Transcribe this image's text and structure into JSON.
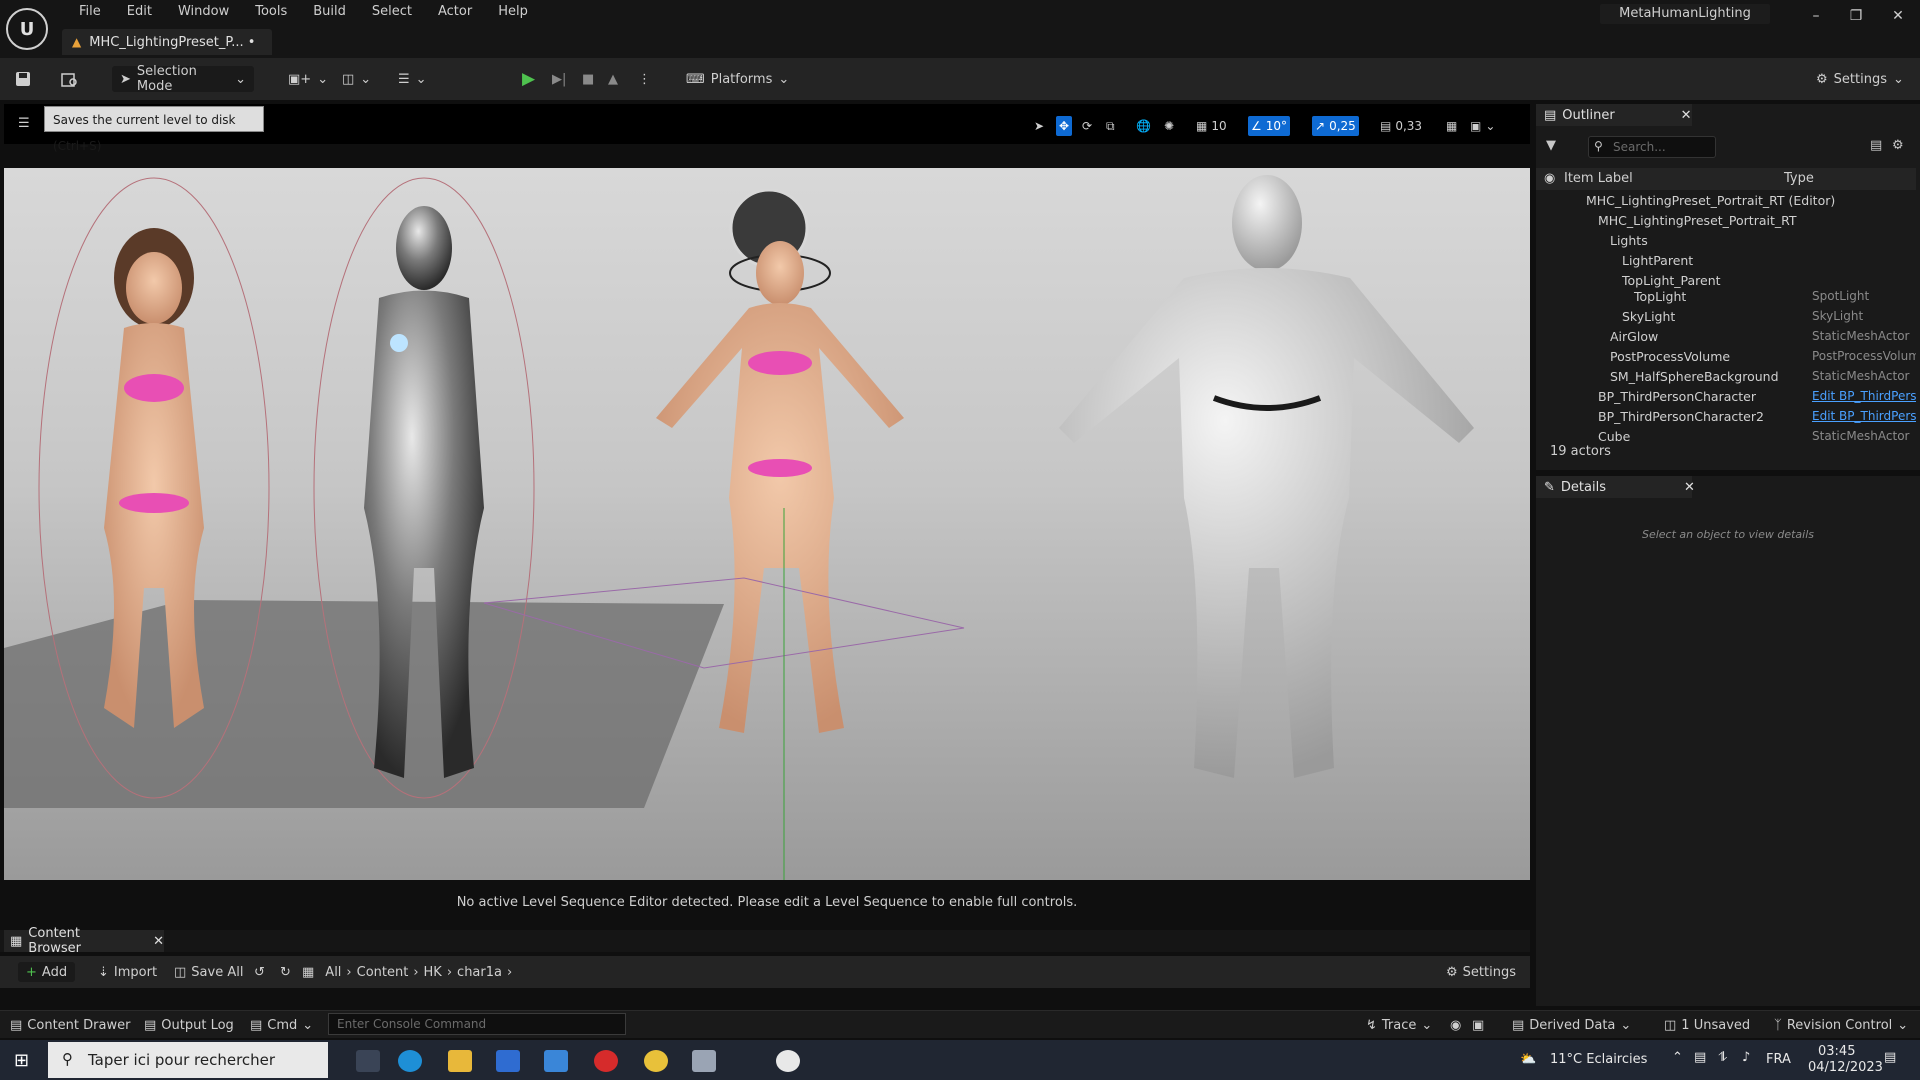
{
  "app": {
    "menu": [
      "File",
      "Edit",
      "Window",
      "Tools",
      "Build",
      "Select",
      "Actor",
      "Help"
    ],
    "project_name": "MetaHumanLighting",
    "doc_tab": "MHC_LightingPreset_P... •"
  },
  "toolbar": {
    "selection_mode": "Selection Mode",
    "platforms": "Platforms",
    "settings": "Settings"
  },
  "viewport": {
    "tooltip": "Saves the current level to disk (Ctrl+S)",
    "grid_snap": "10",
    "rotation_snap": "10°",
    "scale_snap": "0,25",
    "camera_speed": "0,33",
    "status_message": "No active Level Sequence Editor detected. Please edit a Level Sequence to enable full controls."
  },
  "content_browser": {
    "tab_label": "Content Browser",
    "add": "Add",
    "import": "Import",
    "save_all": "Save All",
    "breadcrumb": [
      "All",
      "Content",
      "HK",
      "char1a"
    ],
    "settings": "Settings"
  },
  "bottom_bar": {
    "content_drawer": "Content Drawer",
    "output_log": "Output Log",
    "cmd": "Cmd",
    "console_placeholder": "Enter Console Command",
    "trace": "Trace",
    "derived_data": "Derived Data",
    "unsaved": "1 Unsaved",
    "revision_control": "Revision Control"
  },
  "outliner": {
    "tab_label": "Outliner",
    "search_placeholder": "Search...",
    "col_label": "Item Label",
    "col_type": "Type",
    "rows": [
      {
        "label": "MHC_LightingPreset_Portrait_RT (Editor)",
        "type": "",
        "indent": 0
      },
      {
        "label": "MHC_LightingPreset_Portrait_RT",
        "type": "",
        "indent": 1
      },
      {
        "label": "Lights",
        "type": "",
        "indent": 2
      },
      {
        "label": "LightParent",
        "type": "",
        "indent": 3
      },
      {
        "label": "TopLight_Parent",
        "type": "",
        "indent": 3
      },
      {
        "label": "TopLight",
        "type": "SpotLight",
        "indent": 4
      },
      {
        "label": "SkyLight",
        "type": "SkyLight",
        "indent": 3
      },
      {
        "label": "AirGlow",
        "type": "StaticMeshActor",
        "indent": 2
      },
      {
        "label": "PostProcessVolume",
        "type": "PostProcessVolume",
        "indent": 2
      },
      {
        "label": "SM_HalfSphereBackground",
        "type": "StaticMeshActor",
        "indent": 2
      },
      {
        "label": "BP_ThirdPersonCharacter",
        "type": "Edit BP_ThirdPersonCharacter",
        "indent": 1
      },
      {
        "label": "BP_ThirdPersonCharacter2",
        "type": "Edit BP_ThirdPersonCharacter",
        "indent": 1
      },
      {
        "label": "Cube",
        "type": "StaticMeshActor",
        "indent": 1
      }
    ],
    "actors_count": "19 actors"
  },
  "details": {
    "tab_label": "Details",
    "empty_message": "Select an object to view details"
  },
  "taskbar": {
    "search_placeholder": "Taper ici pour rechercher",
    "weather": "11°C  Eclaircies",
    "lang": "FRA",
    "time": "03:45",
    "date": "04/12/2023"
  },
  "colors": {
    "accent": "#0e6ad3",
    "play_green": "#4fc24f",
    "link_blue": "#4aa0ff",
    "warning": "#e8a13a"
  }
}
